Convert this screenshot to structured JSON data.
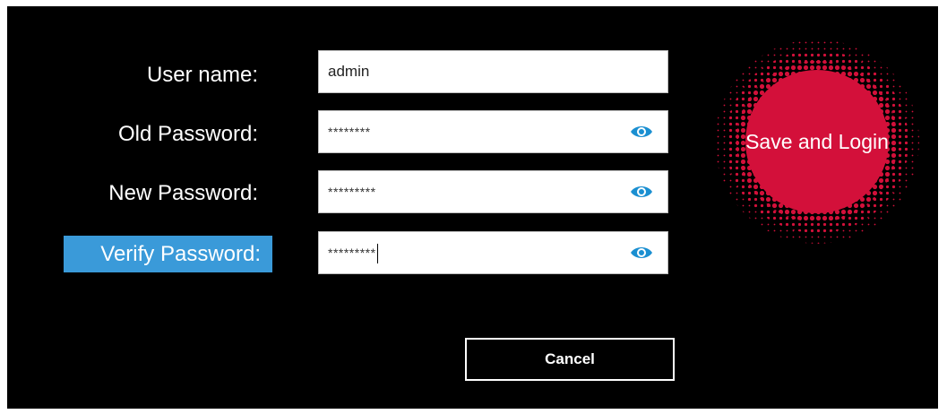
{
  "form": {
    "username_label": "User name:",
    "old_password_label": "Old Password:",
    "new_password_label": "New Password:",
    "verify_password_label": "Verify Password:",
    "username_value": "admin",
    "old_password_value": "********",
    "new_password_value": "*********",
    "verify_password_value": "*********"
  },
  "actions": {
    "save_label": "Save and Login",
    "cancel_label": "Cancel"
  },
  "icons": {
    "show_password": "eye-icon"
  },
  "colors": {
    "background": "#000000",
    "active_label": "#3a9ad9",
    "eye_icon": "#1a8fd1",
    "save_button": "#d3103a"
  }
}
